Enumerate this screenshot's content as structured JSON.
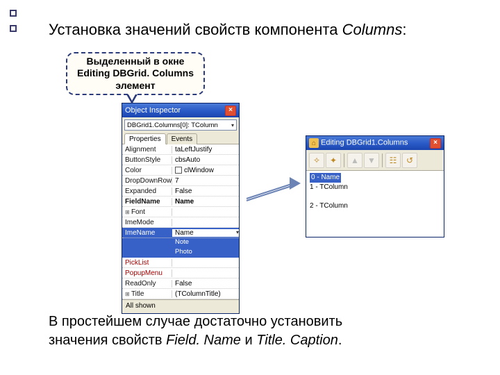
{
  "heading": {
    "prefix": "Установка значений свойств компонента  ",
    "italic": "Columns",
    "suffix": ":"
  },
  "callout": {
    "line1": "Выделенный в окне",
    "line2": "Editing DBGrid. Columns",
    "line3": "элемент"
  },
  "object_inspector": {
    "title": "Object Inspector",
    "selector": "DBGrid1.Columns[0]: TColumn",
    "tabs": {
      "properties": "Properties",
      "events": "Events"
    },
    "props": [
      {
        "name": "Alignment",
        "val": "taLeftJustify"
      },
      {
        "name": "ButtonStyle",
        "val": "cbsAuto"
      },
      {
        "name": "Color",
        "val": "clWindow",
        "checkbox": true
      },
      {
        "name": "DropDownRows",
        "val": "7"
      },
      {
        "name": "Expanded",
        "val": "False"
      },
      {
        "name": "FieldName",
        "val": "Name",
        "bold": true
      },
      {
        "name": "Font",
        "val": "",
        "expand": true
      },
      {
        "name": "ImeMode",
        "val": ""
      },
      {
        "name": "ImeName",
        "val": "",
        "selected": true,
        "dropdown": true,
        "selvalue": "Name"
      },
      {
        "name": "",
        "val": "Note",
        "option": true
      },
      {
        "name": "",
        "val": "Photo",
        "option": true
      },
      {
        "name": "PickList",
        "val": "",
        "red": true
      },
      {
        "name": "PopupMenu",
        "val": "",
        "red": true
      },
      {
        "name": "ReadOnly",
        "val": "False"
      },
      {
        "name": "Title",
        "val": "(TColumnTitle)",
        "expand": true
      }
    ],
    "footer": "All shown"
  },
  "editor": {
    "title": "Editing DBGrid1.Columns",
    "items": [
      {
        "label": "0 - Name",
        "selected": true
      },
      {
        "label": "1 - TColumn"
      },
      {
        "label": "2 - TColumn"
      }
    ],
    "icons": [
      "add",
      "delete",
      "up",
      "down",
      "all",
      "restore"
    ]
  },
  "bottom": {
    "line1": "В простейшем случае достаточно установить",
    "line2a": "значения свойств  ",
    "field": "Field. Name",
    "and": "  и  ",
    "title": "Title. Caption",
    "dot": "."
  }
}
